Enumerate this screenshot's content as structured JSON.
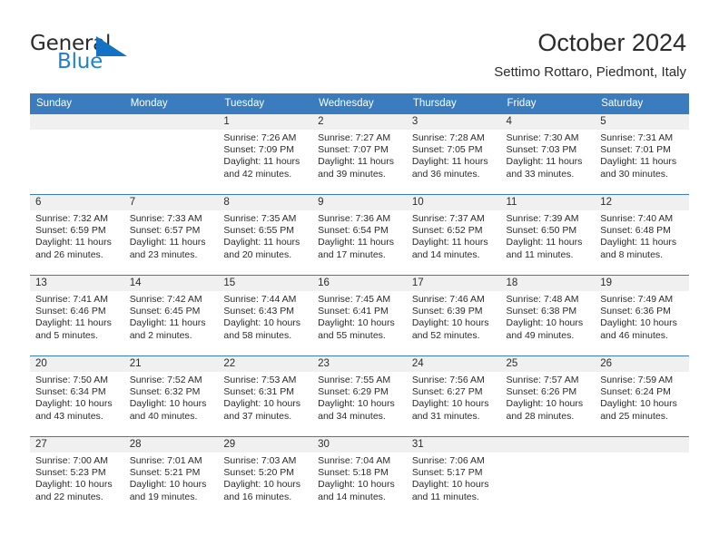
{
  "brand": {
    "name_part1": "General",
    "name_part2": "Blue",
    "flag_color": "#1f7fd0"
  },
  "header": {
    "title": "October 2024",
    "subtitle": "Settimo Rottaro, Piedmont, Italy",
    "header_bg": "#3a7cbe"
  },
  "weekdays": [
    "Sunday",
    "Monday",
    "Tuesday",
    "Wednesday",
    "Thursday",
    "Friday",
    "Saturday"
  ],
  "weeks": [
    [
      {
        "day": "",
        "sunrise": "",
        "sunset": "",
        "daylight_line1": "",
        "daylight_line2": ""
      },
      {
        "day": "",
        "sunrise": "",
        "sunset": "",
        "daylight_line1": "",
        "daylight_line2": ""
      },
      {
        "day": "1",
        "sunrise": "Sunrise: 7:26 AM",
        "sunset": "Sunset: 7:09 PM",
        "daylight_line1": "Daylight: 11 hours",
        "daylight_line2": "and 42 minutes."
      },
      {
        "day": "2",
        "sunrise": "Sunrise: 7:27 AM",
        "sunset": "Sunset: 7:07 PM",
        "daylight_line1": "Daylight: 11 hours",
        "daylight_line2": "and 39 minutes."
      },
      {
        "day": "3",
        "sunrise": "Sunrise: 7:28 AM",
        "sunset": "Sunset: 7:05 PM",
        "daylight_line1": "Daylight: 11 hours",
        "daylight_line2": "and 36 minutes."
      },
      {
        "day": "4",
        "sunrise": "Sunrise: 7:30 AM",
        "sunset": "Sunset: 7:03 PM",
        "daylight_line1": "Daylight: 11 hours",
        "daylight_line2": "and 33 minutes."
      },
      {
        "day": "5",
        "sunrise": "Sunrise: 7:31 AM",
        "sunset": "Sunset: 7:01 PM",
        "daylight_line1": "Daylight: 11 hours",
        "daylight_line2": "and 30 minutes."
      }
    ],
    [
      {
        "day": "6",
        "sunrise": "Sunrise: 7:32 AM",
        "sunset": "Sunset: 6:59 PM",
        "daylight_line1": "Daylight: 11 hours",
        "daylight_line2": "and 26 minutes."
      },
      {
        "day": "7",
        "sunrise": "Sunrise: 7:33 AM",
        "sunset": "Sunset: 6:57 PM",
        "daylight_line1": "Daylight: 11 hours",
        "daylight_line2": "and 23 minutes."
      },
      {
        "day": "8",
        "sunrise": "Sunrise: 7:35 AM",
        "sunset": "Sunset: 6:55 PM",
        "daylight_line1": "Daylight: 11 hours",
        "daylight_line2": "and 20 minutes."
      },
      {
        "day": "9",
        "sunrise": "Sunrise: 7:36 AM",
        "sunset": "Sunset: 6:54 PM",
        "daylight_line1": "Daylight: 11 hours",
        "daylight_line2": "and 17 minutes."
      },
      {
        "day": "10",
        "sunrise": "Sunrise: 7:37 AM",
        "sunset": "Sunset: 6:52 PM",
        "daylight_line1": "Daylight: 11 hours",
        "daylight_line2": "and 14 minutes."
      },
      {
        "day": "11",
        "sunrise": "Sunrise: 7:39 AM",
        "sunset": "Sunset: 6:50 PM",
        "daylight_line1": "Daylight: 11 hours",
        "daylight_line2": "and 11 minutes."
      },
      {
        "day": "12",
        "sunrise": "Sunrise: 7:40 AM",
        "sunset": "Sunset: 6:48 PM",
        "daylight_line1": "Daylight: 11 hours",
        "daylight_line2": "and 8 minutes."
      }
    ],
    [
      {
        "day": "13",
        "sunrise": "Sunrise: 7:41 AM",
        "sunset": "Sunset: 6:46 PM",
        "daylight_line1": "Daylight: 11 hours",
        "daylight_line2": "and 5 minutes."
      },
      {
        "day": "14",
        "sunrise": "Sunrise: 7:42 AM",
        "sunset": "Sunset: 6:45 PM",
        "daylight_line1": "Daylight: 11 hours",
        "daylight_line2": "and 2 minutes."
      },
      {
        "day": "15",
        "sunrise": "Sunrise: 7:44 AM",
        "sunset": "Sunset: 6:43 PM",
        "daylight_line1": "Daylight: 10 hours",
        "daylight_line2": "and 58 minutes."
      },
      {
        "day": "16",
        "sunrise": "Sunrise: 7:45 AM",
        "sunset": "Sunset: 6:41 PM",
        "daylight_line1": "Daylight: 10 hours",
        "daylight_line2": "and 55 minutes."
      },
      {
        "day": "17",
        "sunrise": "Sunrise: 7:46 AM",
        "sunset": "Sunset: 6:39 PM",
        "daylight_line1": "Daylight: 10 hours",
        "daylight_line2": "and 52 minutes."
      },
      {
        "day": "18",
        "sunrise": "Sunrise: 7:48 AM",
        "sunset": "Sunset: 6:38 PM",
        "daylight_line1": "Daylight: 10 hours",
        "daylight_line2": "and 49 minutes."
      },
      {
        "day": "19",
        "sunrise": "Sunrise: 7:49 AM",
        "sunset": "Sunset: 6:36 PM",
        "daylight_line1": "Daylight: 10 hours",
        "daylight_line2": "and 46 minutes."
      }
    ],
    [
      {
        "day": "20",
        "sunrise": "Sunrise: 7:50 AM",
        "sunset": "Sunset: 6:34 PM",
        "daylight_line1": "Daylight: 10 hours",
        "daylight_line2": "and 43 minutes."
      },
      {
        "day": "21",
        "sunrise": "Sunrise: 7:52 AM",
        "sunset": "Sunset: 6:32 PM",
        "daylight_line1": "Daylight: 10 hours",
        "daylight_line2": "and 40 minutes."
      },
      {
        "day": "22",
        "sunrise": "Sunrise: 7:53 AM",
        "sunset": "Sunset: 6:31 PM",
        "daylight_line1": "Daylight: 10 hours",
        "daylight_line2": "and 37 minutes."
      },
      {
        "day": "23",
        "sunrise": "Sunrise: 7:55 AM",
        "sunset": "Sunset: 6:29 PM",
        "daylight_line1": "Daylight: 10 hours",
        "daylight_line2": "and 34 minutes."
      },
      {
        "day": "24",
        "sunrise": "Sunrise: 7:56 AM",
        "sunset": "Sunset: 6:27 PM",
        "daylight_line1": "Daylight: 10 hours",
        "daylight_line2": "and 31 minutes."
      },
      {
        "day": "25",
        "sunrise": "Sunrise: 7:57 AM",
        "sunset": "Sunset: 6:26 PM",
        "daylight_line1": "Daylight: 10 hours",
        "daylight_line2": "and 28 minutes."
      },
      {
        "day": "26",
        "sunrise": "Sunrise: 7:59 AM",
        "sunset": "Sunset: 6:24 PM",
        "daylight_line1": "Daylight: 10 hours",
        "daylight_line2": "and 25 minutes."
      }
    ],
    [
      {
        "day": "27",
        "sunrise": "Sunrise: 7:00 AM",
        "sunset": "Sunset: 5:23 PM",
        "daylight_line1": "Daylight: 10 hours",
        "daylight_line2": "and 22 minutes."
      },
      {
        "day": "28",
        "sunrise": "Sunrise: 7:01 AM",
        "sunset": "Sunset: 5:21 PM",
        "daylight_line1": "Daylight: 10 hours",
        "daylight_line2": "and 19 minutes."
      },
      {
        "day": "29",
        "sunrise": "Sunrise: 7:03 AM",
        "sunset": "Sunset: 5:20 PM",
        "daylight_line1": "Daylight: 10 hours",
        "daylight_line2": "and 16 minutes."
      },
      {
        "day": "30",
        "sunrise": "Sunrise: 7:04 AM",
        "sunset": "Sunset: 5:18 PM",
        "daylight_line1": "Daylight: 10 hours",
        "daylight_line2": "and 14 minutes."
      },
      {
        "day": "31",
        "sunrise": "Sunrise: 7:06 AM",
        "sunset": "Sunset: 5:17 PM",
        "daylight_line1": "Daylight: 10 hours",
        "daylight_line2": "and 11 minutes."
      },
      {
        "day": "",
        "sunrise": "",
        "sunset": "",
        "daylight_line1": "",
        "daylight_line2": ""
      },
      {
        "day": "",
        "sunrise": "",
        "sunset": "",
        "daylight_line1": "",
        "daylight_line2": ""
      }
    ]
  ]
}
